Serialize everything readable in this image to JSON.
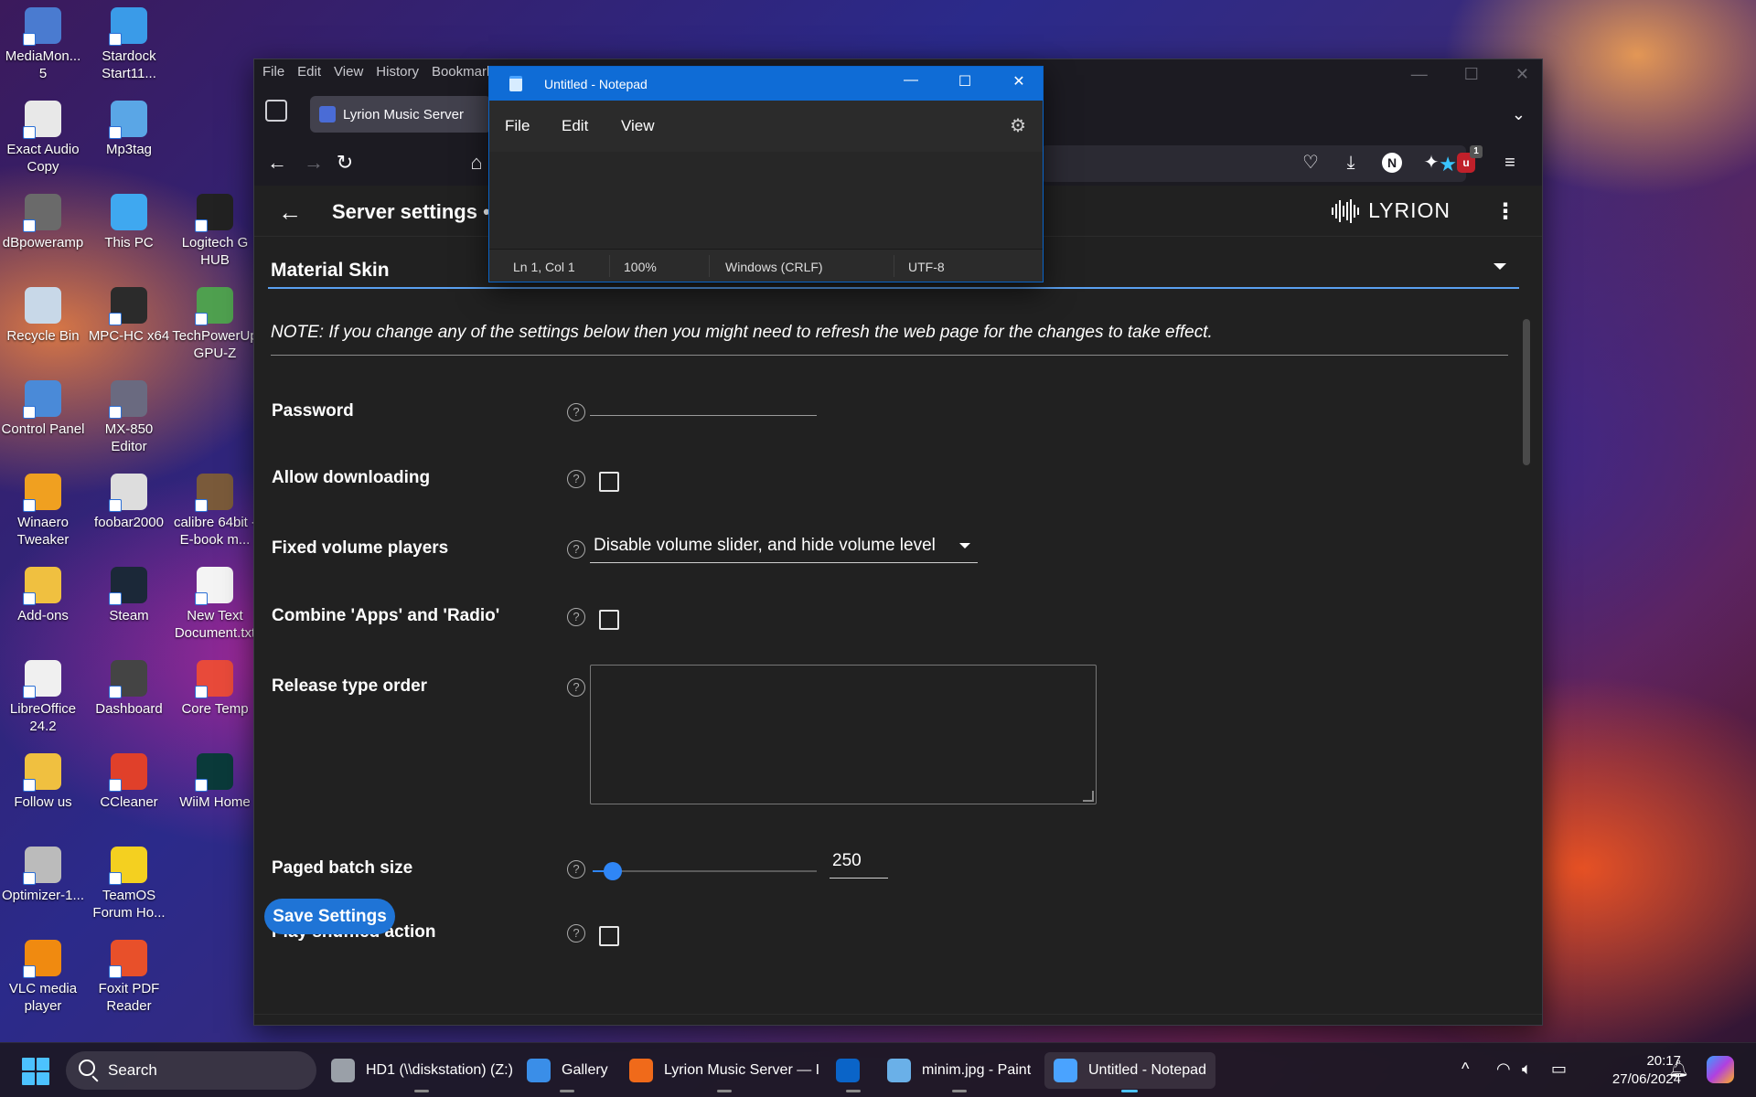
{
  "desktop_icons": [
    {
      "label": "MediaMon... 5",
      "color": "#4a7bd0"
    },
    {
      "label": "Stardock Start11...",
      "color": "#3a9be8"
    },
    {
      "label": "Exact Audio Copy",
      "color": "#e8e8e8"
    },
    {
      "label": "Mp3tag",
      "color": "#5aa6e6"
    },
    {
      "label": "dBpoweramp",
      "color": "#6a6a6a"
    },
    {
      "label": "This PC",
      "color": "#3fa8f0"
    },
    {
      "label": "Logitech G HUB",
      "color": "#222222"
    },
    {
      "label": "Recycle Bin",
      "color": "#c8d8e8"
    },
    {
      "label": "MPC-HC x64",
      "color": "#2b2b2b"
    },
    {
      "label": "TechPowerUp GPU-Z",
      "color": "#4fa04f"
    },
    {
      "label": "Control Panel",
      "color": "#4a8ad8"
    },
    {
      "label": "MX-850 Editor",
      "color": "#6a6a80"
    },
    {
      "label": "Winaero Tweaker",
      "color": "#f0a020"
    },
    {
      "label": "foobar2000",
      "color": "#dddddd"
    },
    {
      "label": "calibre 64bit - E-book m...",
      "color": "#7a5a3a"
    },
    {
      "label": "Add-ons",
      "color": "#f0c040"
    },
    {
      "label": "Steam",
      "color": "#1b2838"
    },
    {
      "label": "New Text Document.txt",
      "color": "#f4f4f4"
    },
    {
      "label": "LibreOffice 24.2",
      "color": "#f0f0f0"
    },
    {
      "label": "Dashboard",
      "color": "#444444"
    },
    {
      "label": "Core Temp",
      "color": "#e84a3a"
    },
    {
      "label": "Follow us",
      "color": "#f0c040"
    },
    {
      "label": "CCleaner",
      "color": "#e0402a"
    },
    {
      "label": "WiiM Home",
      "color": "#0a3a3a"
    },
    {
      "label": "Optimizer-1...",
      "color": "#bbbbbb"
    },
    {
      "label": "TeamOS Forum Ho...",
      "color": "#f4d020"
    },
    {
      "label": "VLC media player",
      "color": "#f08a10"
    },
    {
      "label": "Foxit PDF Reader",
      "color": "#e8502a"
    }
  ],
  "firefox": {
    "menu": [
      "File",
      "Edit",
      "View",
      "History",
      "Bookmarks"
    ],
    "tab_title": "Lyrion Music Server",
    "win_min": "—",
    "win_max": "☐",
    "win_close": "✕"
  },
  "app": {
    "title": "Server settings •",
    "brand": "LYRION",
    "section": "Material Skin",
    "note": "NOTE: If you change any of the settings below then you might need to refresh the web page for the changes to take effect.",
    "rows": {
      "password_label": "Password",
      "allow_downloading_label": "Allow downloading",
      "fixed_volume_label": "Fixed volume players",
      "fixed_volume_value": "Disable volume slider, and hide volume level",
      "combine_label": "Combine 'Apps' and 'Radio'",
      "release_order_label": "Release type order",
      "paged_batch_label": "Paged batch size",
      "paged_batch_value": "250",
      "paged_batch_fraction": 0.09,
      "play_shuffled_label": "Play shuffled action"
    },
    "save_button": "Save Settings",
    "help_glyph": "?"
  },
  "notepad": {
    "title": "Untitled - Notepad",
    "menu": [
      "File",
      "Edit",
      "View"
    ],
    "status": {
      "position": "Ln 1, Col 1",
      "zoom": "100%",
      "line_ending": "Windows (CRLF)",
      "encoding": "UTF-8"
    }
  },
  "taskbar": {
    "search_placeholder": "Search",
    "apps": [
      {
        "label": "HD1 (\\\\diskstation) (Z:)",
        "color": "#9aa0a8"
      },
      {
        "label": "Gallery",
        "color": "#3a8ee8"
      },
      {
        "label": "Lyrion Music Server — I",
        "color": "#f06a1a"
      },
      {
        "label": "",
        "color": "#0a64c8"
      },
      {
        "label": "minim.jpg - Paint",
        "color": "#6ab0e8"
      },
      {
        "label": "Untitled - Notepad",
        "color": "#4aa3ff"
      }
    ],
    "time": "20:17",
    "date": "27/06/2024",
    "tray_chevron": "^"
  }
}
